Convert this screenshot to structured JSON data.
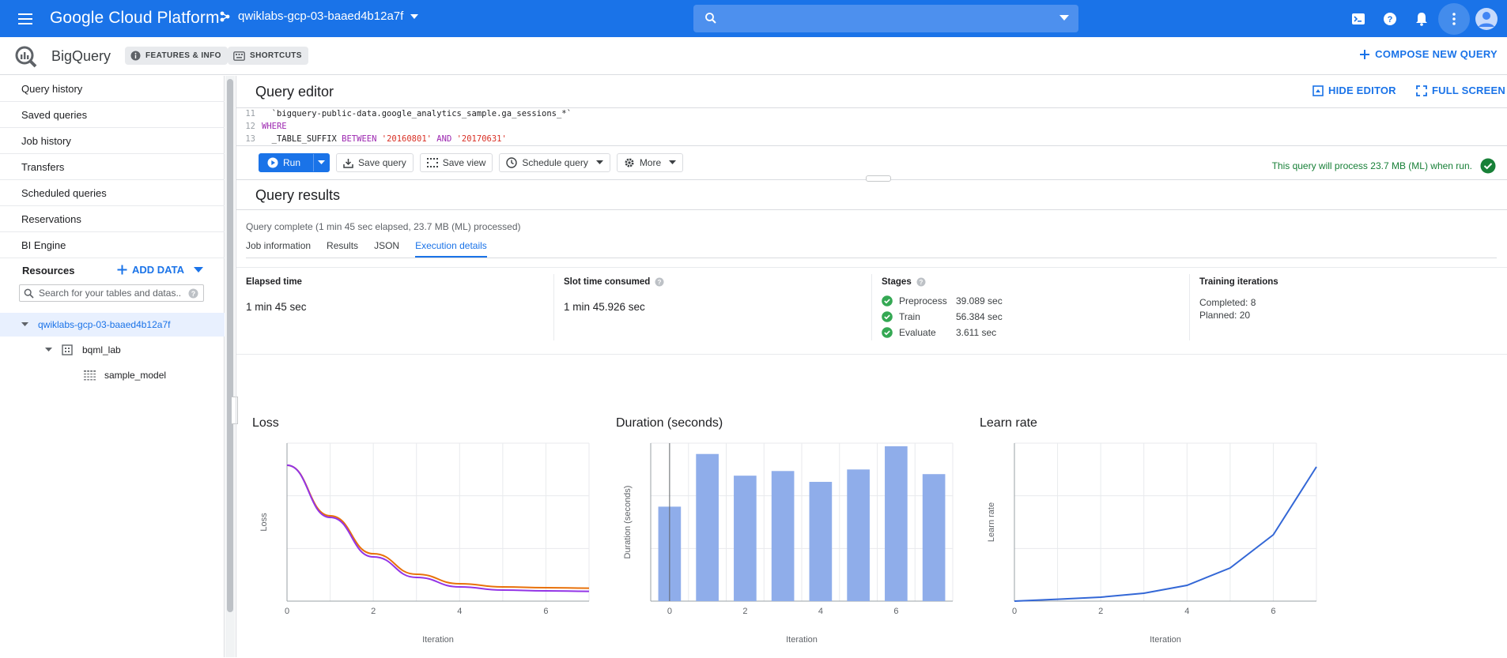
{
  "topbar": {
    "brand": "Google Cloud Platform",
    "project": "qwiklabs-gcp-03-baaed4b12a7f",
    "search_placeholder": "",
    "icons": [
      "cloud-shell-icon",
      "help-icon",
      "notifications-icon",
      "more-vert-icon",
      "account-icon"
    ]
  },
  "product": {
    "title": "BigQuery",
    "features_label": "FEATURES & INFO",
    "shortcuts_label": "SHORTCUTS",
    "compose_label": "COMPOSE NEW QUERY"
  },
  "nav": {
    "items": [
      "Query history",
      "Saved queries",
      "Job history",
      "Transfers",
      "Scheduled queries",
      "Reservations",
      "BI Engine"
    ],
    "resources_title": "Resources",
    "add_data_label": "ADD DATA",
    "search_placeholder": "Search for your tables and datas...",
    "tree": {
      "project": "qwiklabs-gcp-03-baaed4b12a7f",
      "dataset": "bqml_lab",
      "model": "sample_model"
    }
  },
  "editor": {
    "title": "Query editor",
    "hide_label": "HIDE EDITOR",
    "fullscreen_label": "FULL SCREEN",
    "lines": [
      {
        "num": "11",
        "text": "  `bigquery-public-data.google_analytics_sample.ga_sessions_*`"
      },
      {
        "num": "12",
        "text": "WHERE"
      },
      {
        "num": "13",
        "pre": "  _TABLE_SUFFIX ",
        "kw": "BETWEEN",
        "s1": "'20160801'",
        "and": "AND",
        "s2": "'20170631'"
      }
    ],
    "buttons": {
      "run": "Run",
      "save_query": "Save query",
      "save_view": "Save view",
      "schedule": "Schedule query",
      "more": "More"
    },
    "validator": "This query will process 23.7 MB (ML) when run."
  },
  "results": {
    "title": "Query results",
    "status": "Query complete (1 min 45 sec elapsed, 23.7 MB (ML) processed)",
    "tabs": [
      "Job information",
      "Results",
      "JSON",
      "Execution details"
    ],
    "active_tab": "Execution details",
    "elapsed": {
      "label": "Elapsed time",
      "value": "1 min 45 sec"
    },
    "slot": {
      "label": "Slot time consumed",
      "value": "1 min 45.926 sec"
    },
    "stages": {
      "label": "Stages",
      "items": [
        {
          "name": "Preprocess",
          "time": "39.089 sec"
        },
        {
          "name": "Train",
          "time": "56.384 sec"
        },
        {
          "name": "Evaluate",
          "time": "3.611 sec"
        }
      ]
    },
    "training": {
      "label": "Training iterations",
      "completed": "Completed: 8",
      "planned": "Planned: 20"
    }
  },
  "colors": {
    "accent": "#1a73e8",
    "success": "#34a853",
    "loss_train": "#e8710a",
    "loss_eval": "#9334e6",
    "bar": "#8fadea",
    "learn": "#3367d6"
  },
  "chart_data": [
    {
      "type": "line",
      "title": "Loss",
      "xlabel": "Iteration",
      "ylabel": "Loss",
      "x": [
        0,
        1,
        2,
        3,
        4,
        5,
        6,
        7
      ],
      "xticks": [
        0,
        2,
        4,
        6
      ],
      "ylim": [
        0,
        1
      ],
      "series": [
        {
          "values": [
            0.86,
            0.54,
            0.3,
            0.17,
            0.11,
            0.09,
            0.085,
            0.082
          ]
        },
        {
          "values": [
            0.86,
            0.53,
            0.28,
            0.15,
            0.09,
            0.07,
            0.065,
            0.062
          ]
        }
      ]
    },
    {
      "type": "bar",
      "title": "Duration (seconds)",
      "xlabel": "Iteration",
      "ylabel": "Duration (seconds)",
      "categories": [
        0,
        1,
        2,
        3,
        4,
        5,
        6,
        7
      ],
      "xticks": [
        0,
        2,
        4,
        6
      ],
      "values": [
        6.1,
        9.5,
        8.1,
        8.4,
        7.7,
        8.5,
        10.0,
        8.2
      ],
      "ylim": [
        0,
        10.2
      ]
    },
    {
      "type": "line",
      "title": "Learn rate",
      "xlabel": "Iteration",
      "ylabel": "Learn rate",
      "x": [
        0,
        1,
        2,
        3,
        4,
        5,
        6,
        7
      ],
      "xticks": [
        0,
        2,
        4,
        6
      ],
      "ylim": [
        0,
        1
      ],
      "series": [
        {
          "values": [
            0.0,
            0.012,
            0.025,
            0.05,
            0.1,
            0.21,
            0.42,
            0.85
          ]
        }
      ]
    }
  ]
}
